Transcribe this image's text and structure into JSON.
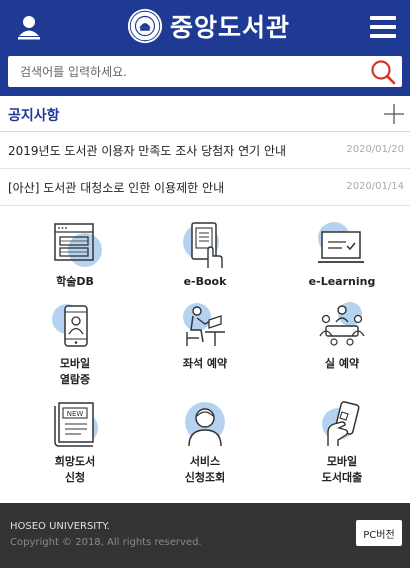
{
  "header": {
    "title": "중앙도서관",
    "colors": {
      "bar": "#1f3a93",
      "accent": "#b5d3f0",
      "search_icon": "#d8332a"
    },
    "icons": {
      "left": "user-icon",
      "right": "hamburger-menu-icon",
      "logo": "university-seal-icon"
    }
  },
  "search": {
    "placeholder": "검색어를 입력하세요.",
    "value": ""
  },
  "notice": {
    "title": "공지사항",
    "items": [
      {
        "text": "2019년도 도서관 이용자 만족도 조사 당첨자 연기 안내",
        "date": "2020/01/20"
      },
      {
        "text": "[아산] 도서관 대청소로 인한 이용제한 안내",
        "date": "2020/01/14"
      }
    ]
  },
  "services": [
    {
      "label": [
        "학술DB"
      ],
      "icon": "database-screen-icon"
    },
    {
      "label": [
        "e-Book"
      ],
      "icon": "ebook-tablet-icon"
    },
    {
      "label": [
        "e-Learning"
      ],
      "icon": "monitor-check-icon"
    },
    {
      "label": [
        "모바일",
        "열람증"
      ],
      "icon": "mobile-id-icon"
    },
    {
      "label": [
        "좌석 예약"
      ],
      "icon": "seat-reading-icon"
    },
    {
      "label": [
        "실 예약"
      ],
      "icon": "group-room-icon"
    },
    {
      "label": [
        "희망도서",
        "신청"
      ],
      "icon": "new-book-icon"
    },
    {
      "label": [
        "서비스",
        "신청조회"
      ],
      "icon": "person-service-icon"
    },
    {
      "label": [
        "모바일",
        "도서대출"
      ],
      "icon": "phone-hand-icon"
    }
  ],
  "footer": {
    "line1": "HOSEO UNIVERSITY.",
    "line2": "Copyright © 2018, All rights reserved.",
    "pc_button": "PC버전"
  }
}
